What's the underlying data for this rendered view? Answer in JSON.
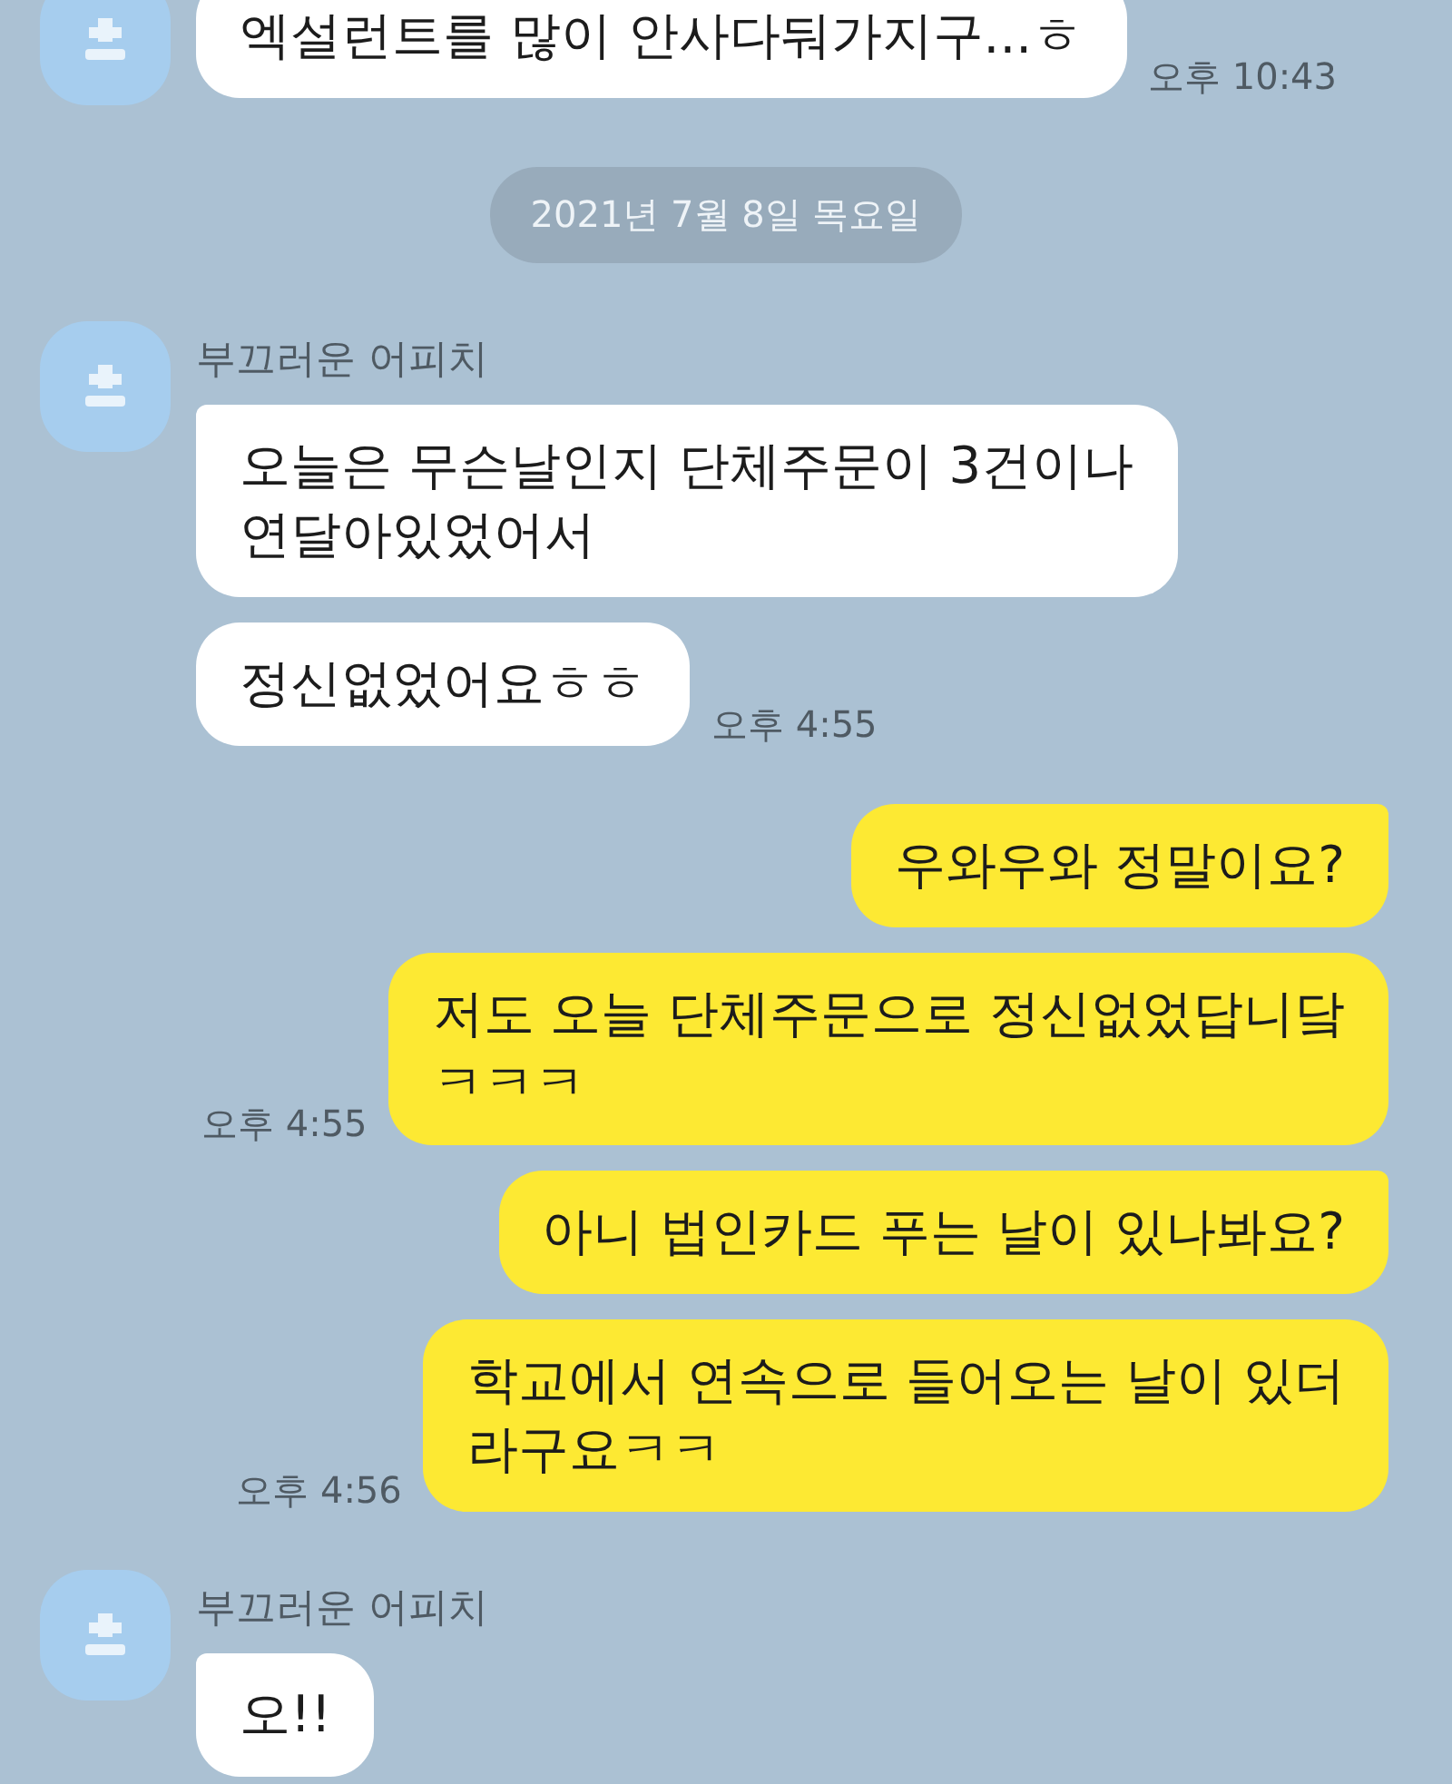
{
  "chat": [
    {
      "kind": "incoming",
      "messages": [
        "엑설런트를 많이 안사다둬가지구...ㅎ"
      ],
      "time": "오후 10:43"
    },
    {
      "kind": "date",
      "label": "2021년 7월 8일 목요일"
    },
    {
      "kind": "incoming",
      "sender": "부끄러운 어피치",
      "messages": [
        "오늘은 무슨날인지 단체주문이 3건이나\n연달아있었어서",
        "정신없었어요ㅎㅎ"
      ],
      "time": "오후 4:55"
    },
    {
      "kind": "outgoing",
      "messages": [
        "우와우와 정말이요?",
        "저도 오늘 단체주문으로 정신없었답니닼\nㅋㅋㅋ"
      ],
      "time": "오후 4:55"
    },
    {
      "kind": "outgoing",
      "messages": [
        "아니 법인카드 푸는 날이 있나봐요?",
        "학교에서 연속으로 들어오는 날이 있더\n라구요ㅋㅋ"
      ],
      "time": "오후 4:56"
    },
    {
      "kind": "incoming",
      "sender": "부끄러운 어피치",
      "messages": [
        "오!!"
      ]
    }
  ]
}
